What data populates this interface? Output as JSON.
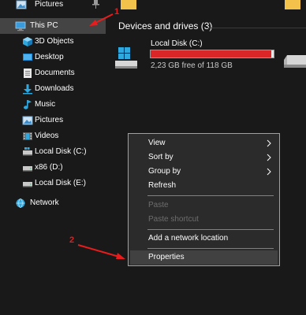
{
  "sidebar": {
    "pinned_item": {
      "label": "Pictures",
      "icon": "pictures-folder-icon"
    },
    "this_pc": {
      "label": "This PC",
      "icon": "computer-icon"
    },
    "items": [
      {
        "label": "3D Objects",
        "icon": "3d-objects-folder-icon"
      },
      {
        "label": "Desktop",
        "icon": "desktop-folder-icon"
      },
      {
        "label": "Documents",
        "icon": "documents-folder-icon"
      },
      {
        "label": "Downloads",
        "icon": "downloads-folder-icon"
      },
      {
        "label": "Music",
        "icon": "music-folder-icon"
      },
      {
        "label": "Pictures",
        "icon": "pictures-folder-icon"
      },
      {
        "label": "Videos",
        "icon": "videos-folder-icon"
      },
      {
        "label": "Local Disk (C:)",
        "icon": "local-disk-icon"
      },
      {
        "label": "x86 (D:)",
        "icon": "drive-icon"
      },
      {
        "label": "Local Disk (E:)",
        "icon": "drive-icon"
      }
    ],
    "network": {
      "label": "Network",
      "icon": "network-icon"
    }
  },
  "main": {
    "group_header": "Devices and drives (3)",
    "drives": [
      {
        "name": "Local Disk (C:)",
        "free_text": "2,23 GB free of 118 GB",
        "used_fraction": 0.98,
        "bar_color": "#da2626",
        "icon": "windows-drive-icon"
      }
    ]
  },
  "context_menu": {
    "items": [
      {
        "label": "View",
        "submenu": true,
        "disabled": false
      },
      {
        "label": "Sort by",
        "submenu": true,
        "disabled": false
      },
      {
        "label": "Group by",
        "submenu": true,
        "disabled": false
      },
      {
        "label": "Refresh",
        "submenu": false,
        "disabled": false
      },
      {
        "label": "Paste",
        "submenu": false,
        "disabled": true
      },
      {
        "label": "Paste shortcut",
        "submenu": false,
        "disabled": true
      },
      {
        "label": "Add a network location",
        "submenu": false,
        "disabled": false
      },
      {
        "label": "Properties",
        "submenu": false,
        "disabled": false,
        "highlighted": true
      }
    ]
  },
  "annotations": {
    "step_1": "1",
    "step_2": "2",
    "color": "#e81c1c"
  },
  "colors": {
    "background": "#191919",
    "selected_row": "#444444",
    "menu_background": "#2b2b2b",
    "menu_highlight": "#414141",
    "folder_yellow": "#f3c24b",
    "accent_blue": "#1e9bd7"
  }
}
